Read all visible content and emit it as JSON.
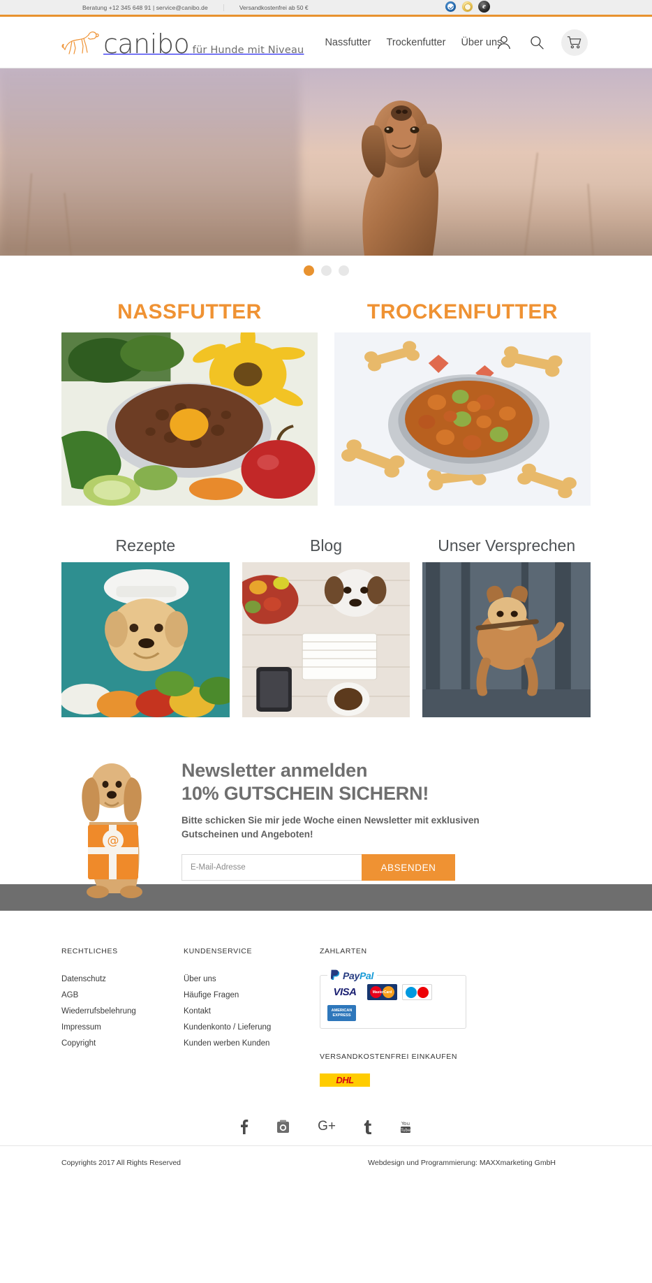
{
  "topbar": {
    "contact": "Beratung +12 345 648 91 | service@canibo.de",
    "shipping": "Versandkostenfrei ab 50 €",
    "badges": [
      {
        "name": "trusted-shops-badge",
        "glyph": ""
      },
      {
        "name": "gold-seal-badge",
        "glyph": ""
      },
      {
        "name": "ehi-seal-badge",
        "glyph": "e"
      }
    ]
  },
  "header": {
    "logo_word": "canibo",
    "logo_tagline": "für Hunde mit Niveau",
    "nav": [
      {
        "label": "Nassfutter",
        "name": "nav-nassfutter"
      },
      {
        "label": "Trockenfutter",
        "name": "nav-trockenfutter"
      },
      {
        "label": "Über uns",
        "name": "nav-ueber-uns"
      }
    ],
    "icons": {
      "account": "account-icon",
      "search": "search-icon",
      "cart": "cart-icon"
    }
  },
  "hero": {
    "slides_total": 3,
    "active_slide": 1,
    "alt": "Vizsla dog in field at sunset"
  },
  "categories": [
    {
      "title": "NASSFUTTER",
      "name": "category-nassfutter",
      "image": "wet-food-bowl-with-vegetables"
    },
    {
      "title": "TROCKENFUTTER",
      "name": "category-trockenfutter",
      "image": "dry-food-bowl-with-biscuits"
    }
  ],
  "trio": [
    {
      "title": "Rezepte",
      "name": "tile-rezepte",
      "image": "golden-retriever-chef-hat"
    },
    {
      "title": "Blog",
      "name": "tile-blog",
      "image": "jack-russell-with-notebook"
    },
    {
      "title": "Unser Versprechen",
      "name": "tile-unser-versprechen",
      "image": "dog-jumping-with-stick"
    }
  ],
  "newsletter": {
    "heading_line1": "Newsletter anmelden",
    "heading_line2": "10% GUTSCHEIN SICHERN!",
    "description": "Bitte schicken Sie mir jede Woche einen Newsletter mit exklusiven Gutscheinen und Angeboten!",
    "email_placeholder": "E-Mail-Adresse",
    "email_value": "",
    "submit_label": "ABSENDEN",
    "image": "cocker-spaniel-with-gift-box"
  },
  "footer": {
    "col_legal": {
      "heading": "RECHTLICHES",
      "links": [
        "Datenschutz",
        "AGB",
        "Wiederrufsbelehrung",
        "Impressum",
        "Copyright"
      ]
    },
    "col_service": {
      "heading": "KUNDENSERVICE",
      "links": [
        "Über uns",
        "Häufige Fragen",
        "Kontakt",
        "Kundenkonto / Lieferung",
        "Kunden werben Kunden"
      ]
    },
    "col_payment": {
      "heading": "ZAHLARTEN",
      "paypal_label_1": "Pay",
      "paypal_label_2": "Pal",
      "cards": [
        "VISA",
        "MasterCard",
        "Maestro",
        "American Express"
      ],
      "shipping_heading": "VERSANDKOSTENFREI EINKAUFEN",
      "carrier": "DHL"
    }
  },
  "social": [
    {
      "name": "facebook-icon",
      "label": "f"
    },
    {
      "name": "instagram-icon",
      "label": ""
    },
    {
      "name": "google-plus-icon",
      "label": "G+"
    },
    {
      "name": "tumblr-icon",
      "label": "t"
    },
    {
      "name": "youtube-icon",
      "label": "You"
    }
  ],
  "bottom": {
    "copyright": "Copyrights 2017 All Rights Reserved",
    "credit": "Webdesign und Programmierung: MAXXmarketing GmbH"
  },
  "colors": {
    "accent": "#ef9233",
    "rule": "#e8922f",
    "band": "#6e6e6e",
    "topbar_bg": "#eeeeee"
  }
}
